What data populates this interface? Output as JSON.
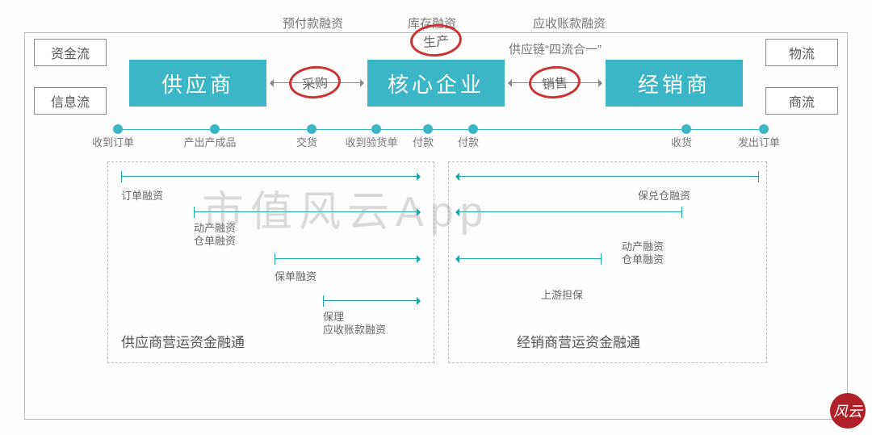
{
  "top_labels": {
    "prepay": "预付款融资",
    "inventory": "库存融资",
    "receivable": "应收账款融资",
    "fourflow": "供应链“四流合一”"
  },
  "side_boxes": {
    "cash": "资金流",
    "info": "信息流",
    "logistics": "物流",
    "commerce": "商流"
  },
  "entities": {
    "supplier": "供应商",
    "core": "核心企业",
    "dealer": "经销商"
  },
  "red_circles": {
    "production": "生产",
    "purchase": "采购",
    "sales": "销售"
  },
  "timeline_nodes": [
    "收到订单",
    "产出产成品",
    "交货",
    "收到验货单",
    "付款",
    "付款",
    "收货",
    "发出订单"
  ],
  "left_panel": {
    "l1": "订单融资",
    "l2a": "动产融资",
    "l2b": "仓单融资",
    "l3": "保单融资",
    "l4a": "保理",
    "l4b": "应收账款融资",
    "title": "供应商营运资金融通"
  },
  "right_panel": {
    "r1": "保兑仓融资",
    "r2a": "动产融资",
    "r2b": "仓单融资",
    "r3": "上游担保",
    "title": "经销商营运资金融通"
  },
  "watermark": "市值风云App",
  "stamp": "风云"
}
